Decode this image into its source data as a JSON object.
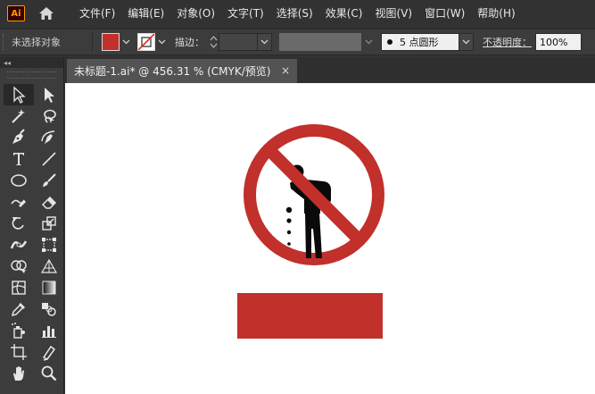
{
  "app": {
    "logo_text": "Ai"
  },
  "menu": {
    "items": [
      "文件(F)",
      "编辑(E)",
      "对象(O)",
      "文字(T)",
      "选择(S)",
      "效果(C)",
      "视图(V)",
      "窗口(W)",
      "帮助(H)"
    ]
  },
  "control_bar": {
    "selection_status": "未选择对象",
    "fill_color": "#c1302b",
    "stroke_label": "描边：",
    "stroke_value": "",
    "brush_value": "5 点圆形",
    "opacity_label": "不透明度：",
    "opacity_value": "100%"
  },
  "document": {
    "tab_title": "未标题-1.ai* @ 456.31 % (CMYK/预览)",
    "close_glyph": "×"
  },
  "toolbar": {
    "collapse_glyph": "◂◂",
    "tools": [
      "selection-tool-icon",
      "direct-selection-tool-icon",
      "magic-wand-tool-icon",
      "lasso-tool-icon",
      "pen-tool-icon",
      "curvature-tool-icon",
      "type-tool-icon",
      "line-segment-tool-icon",
      "ellipse-tool-icon",
      "paintbrush-tool-icon",
      "shaper-tool-icon",
      "eraser-tool-icon",
      "rotate-tool-icon",
      "scale-tool-icon",
      "width-tool-icon",
      "free-transform-tool-icon",
      "shape-builder-tool-icon",
      "perspective-grid-tool-icon",
      "mesh-tool-icon",
      "gradient-tool-icon",
      "eyedropper-tool-icon",
      "blend-tool-icon",
      "symbol-sprayer-tool-icon",
      "column-graph-tool-icon",
      "artboard-tool-icon",
      "slice-tool-icon",
      "hand-tool-icon",
      "zoom-tool-icon"
    ]
  },
  "artwork": {
    "sign_red": "#c1302b",
    "figure_black": "#0a0a0a"
  }
}
